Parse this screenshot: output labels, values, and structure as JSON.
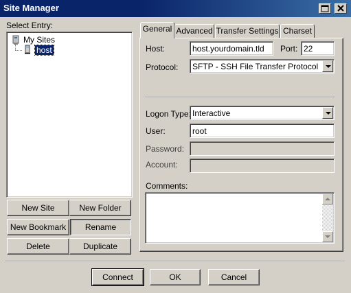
{
  "window": {
    "title": "Site Manager"
  },
  "left": {
    "select_label": "Select Entry:",
    "tree": {
      "root": "My Sites",
      "child": "host"
    },
    "buttons": {
      "new_site": "New Site",
      "new_folder": "New Folder",
      "new_bookmark": "New Bookmark",
      "rename": "Rename",
      "delete": "Delete",
      "duplicate": "Duplicate"
    }
  },
  "tabs": [
    "General",
    "Advanced",
    "Transfer Settings",
    "Charset"
  ],
  "general": {
    "host_label": "Host:",
    "host_value": "host.yourdomain.tld",
    "port_label": "Port:",
    "port_value": "22",
    "protocol_label": "Protocol:",
    "protocol_value": "SFTP - SSH File Transfer Protocol",
    "logon_type_label": "Logon Type:",
    "logon_type_value": "Interactive",
    "user_label": "User:",
    "user_value": "root",
    "password_label": "Password:",
    "account_label": "Account:",
    "comments_label": "Comments:"
  },
  "footer": {
    "connect": "Connect",
    "ok": "OK",
    "cancel": "Cancel"
  },
  "colors": {
    "titlebar": "#0a246a",
    "selection": "#0a246a",
    "face": "#d4d0c8"
  }
}
